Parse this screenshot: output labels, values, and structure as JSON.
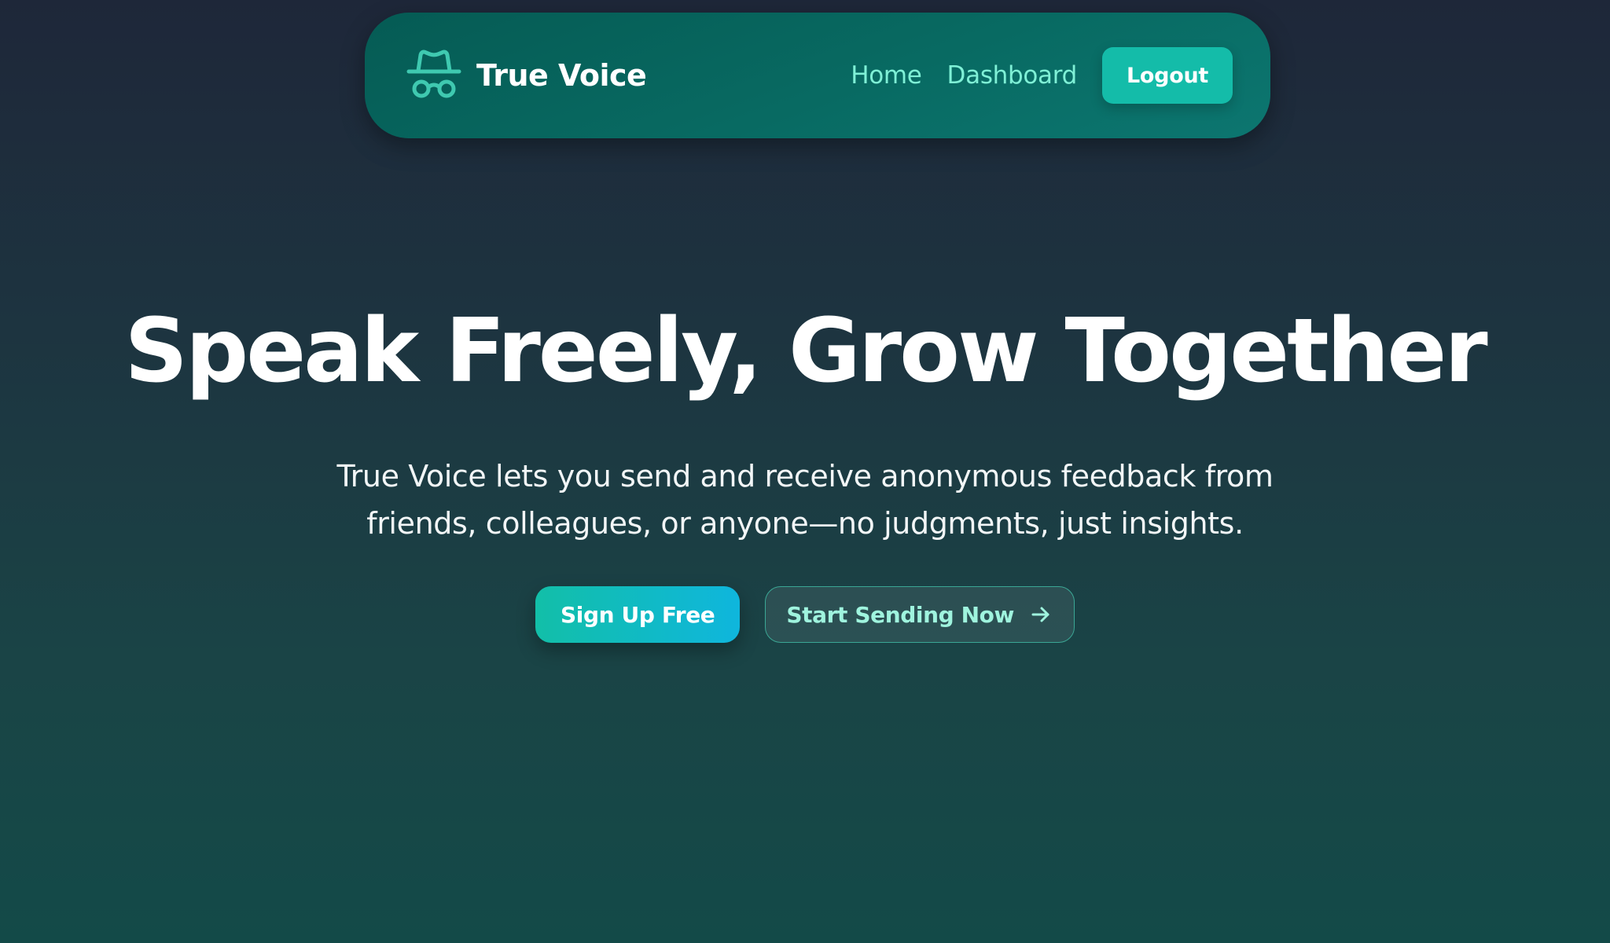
{
  "navbar": {
    "brand_name": "True Voice",
    "brand_icon": "incognito-icon",
    "links": [
      {
        "label": "Home"
      },
      {
        "label": "Dashboard"
      }
    ],
    "logout_label": "Logout"
  },
  "hero": {
    "title": "Speak Freely, Grow Together",
    "subtitle": "True Voice lets you send and receive anonymous feedback from friends, colleagues, or anyone—no judgments, just insights.",
    "primary_cta": "Sign Up Free",
    "secondary_cta": "Start Sending Now",
    "secondary_cta_icon": "arrow-right-icon"
  },
  "colors": {
    "accent": "#14bca9",
    "link": "#7ff0d6",
    "navbar_bg": "#086a62",
    "page_bg_top": "#1e2739",
    "page_bg_bottom": "#134a48"
  }
}
